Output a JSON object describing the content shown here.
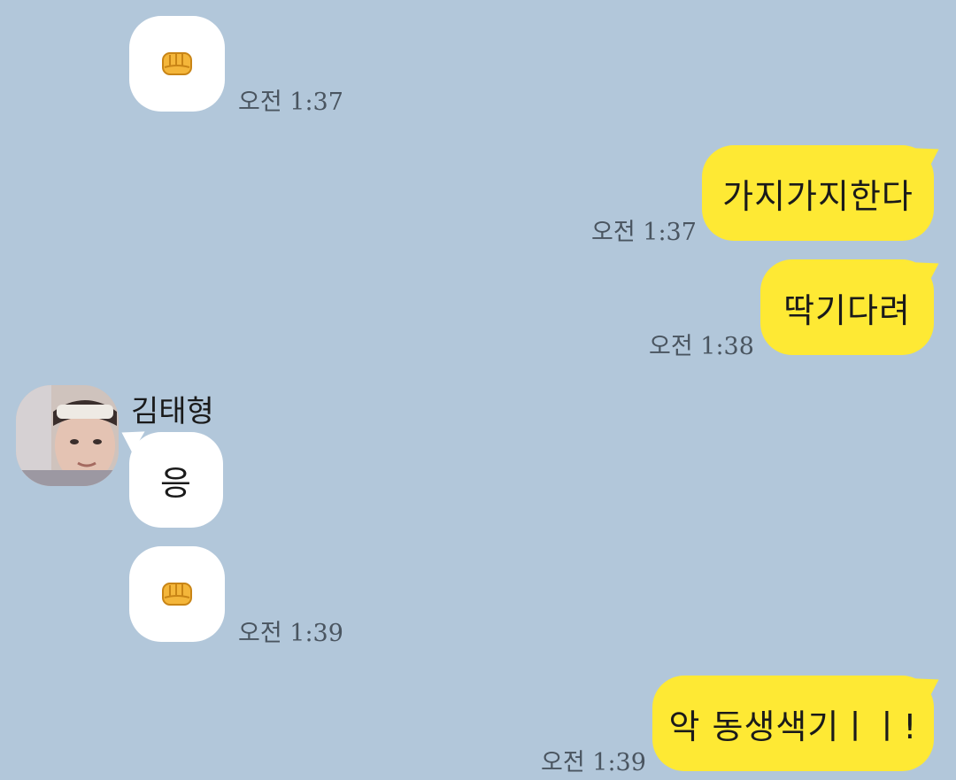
{
  "colors": {
    "background": "#b2c7da",
    "incoming_bubble": "#ffffff",
    "outgoing_bubble": "#fee934",
    "timestamp": "#4a5560"
  },
  "messages": [
    {
      "direction": "in",
      "type": "emoji",
      "icon": "fist-emoji-icon",
      "time": "오전 1:37"
    },
    {
      "direction": "out",
      "type": "text",
      "text": "가지가지한다",
      "time": "오전 1:37"
    },
    {
      "direction": "out",
      "type": "text",
      "text": "딱기다려",
      "time": "오전 1:38"
    },
    {
      "direction": "in",
      "type": "text",
      "sender": "김태형",
      "text": "응"
    },
    {
      "direction": "in",
      "type": "emoji",
      "icon": "fist-emoji-icon",
      "time": "오전 1:39"
    },
    {
      "direction": "out",
      "type": "text",
      "text": "악 동생색기ㅣㅣ!",
      "time": "오전 1:39"
    }
  ]
}
